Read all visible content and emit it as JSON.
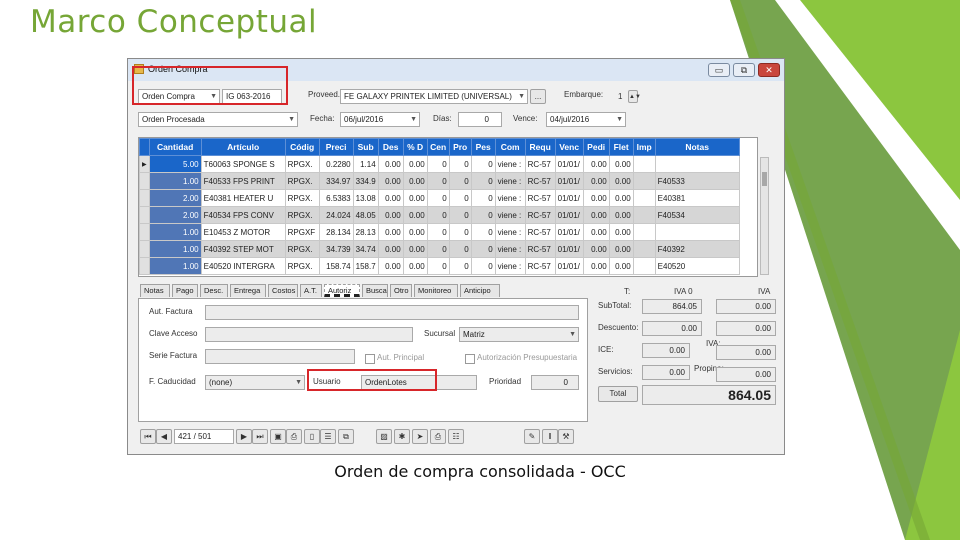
{
  "slide": {
    "title": "Marco Conceptual",
    "caption": "Orden de compra consolidada - OCC",
    "colors": {
      "title": "#76a636",
      "accent_green_dark": "#5f9530",
      "accent_green_light": "#8cc63f",
      "highlight_red": "#d7262a",
      "grid_header": "#1a66c9"
    }
  },
  "window": {
    "title": "Orden Compra",
    "controls": {
      "minimize": "▭",
      "restore": "⧉",
      "close": "✕"
    },
    "tipo": "Orden Compra",
    "numero": "IG 063-2016",
    "estado": "Orden Procesada",
    "proveedor_label": "Proveed.",
    "proveedor": "FE GALAXY PRINTEK LIMITED (UNIVERSAL)",
    "embarque_label": "Embarque:",
    "embarque": "1",
    "fecha_label": "Fecha:",
    "fecha": "06/jul/2016",
    "dias_label": "Días:",
    "dias": "0",
    "vence_label": "Vence:",
    "vence": "04/jul/2016",
    "ellipsis": "..."
  },
  "grid": {
    "columns": [
      "Cantidad",
      "Artículo",
      "Códig",
      "Preci",
      "Sub",
      "Des",
      "% D",
      "Cen",
      "Pro",
      "Pes",
      "Com",
      "Requ",
      "Venc",
      "Pedi",
      "Flet",
      "Imp",
      "Notas"
    ],
    "rows": [
      {
        "marker": "▶",
        "cells": [
          "5.00",
          "T60063 SPONGE S",
          "RPGX.",
          "0.2280",
          "1.14",
          "0.00",
          "0.00",
          "0",
          "0",
          "0",
          "viene :",
          "RC-57",
          "01/01/",
          "0.00",
          "0.00",
          "",
          ""
        ]
      },
      {
        "marker": "",
        "cells": [
          "1.00",
          "F40533 FPS PRINT",
          "RPGX.",
          "334.97",
          "334.9",
          "0.00",
          "0.00",
          "0",
          "0",
          "0",
          "viene :",
          "RC-57",
          "01/01/",
          "0.00",
          "0.00",
          "",
          "F40533"
        ]
      },
      {
        "marker": "",
        "cells": [
          "2.00",
          "E40381 HEATER U",
          "RPGX.",
          "6.5383",
          "13.08",
          "0.00",
          "0.00",
          "0",
          "0",
          "0",
          "viene :",
          "RC-57",
          "01/01/",
          "0.00",
          "0.00",
          "",
          "E40381"
        ]
      },
      {
        "marker": "",
        "cells": [
          "2.00",
          "F40534 FPS CONV",
          "RPGX.",
          "24.024",
          "48.05",
          "0.00",
          "0.00",
          "0",
          "0",
          "0",
          "viene :",
          "RC-57",
          "01/01/",
          "0.00",
          "0.00",
          "",
          "F40534"
        ]
      },
      {
        "marker": "",
        "cells": [
          "1.00",
          "E10453 Z MOTOR",
          "RPGXF",
          "28.134",
          "28.13",
          "0.00",
          "0.00",
          "0",
          "0",
          "0",
          "viene :",
          "RC-57",
          "01/01/",
          "0.00",
          "0.00",
          "",
          ""
        ]
      },
      {
        "marker": "",
        "cells": [
          "1.00",
          "F40392 STEP MOT",
          "RPGX.",
          "34.739",
          "34.74",
          "0.00",
          "0.00",
          "0",
          "0",
          "0",
          "viene :",
          "RC-57",
          "01/01/",
          "0.00",
          "0.00",
          "",
          "F40392"
        ]
      },
      {
        "marker": "",
        "cells": [
          "1.00",
          "E40520 INTERGRA",
          "RPGX.",
          "158.74",
          "158.7",
          "0.00",
          "0.00",
          "0",
          "0",
          "0",
          "viene :",
          "RC-57",
          "01/01/",
          "0.00",
          "0.00",
          "",
          "E40520"
        ]
      }
    ]
  },
  "tabs": [
    "Notas",
    "Pago",
    "Desc.",
    "Entrega",
    "Costos",
    "A.T.",
    "Autoriz",
    "Busca",
    "Otro",
    "Monitoreo",
    "Anticipo"
  ],
  "autoriz": {
    "aut_factura_label": "Aut. Factura",
    "clave_acceso_label": "Clave Acceso",
    "sucursal_label": "Sucursal",
    "sucursal_value": "Matriz",
    "serie_factura_label": "Serie Factura",
    "aut_principal_label": "Aut. Principal",
    "aut_presupuestaria_label": "Autorización Presupuestaria",
    "caducidad_label": "F. Caducidad",
    "caducidad_value": "(none)",
    "usuario_label": "Usuario",
    "usuario_value": "OrdenLotes",
    "prioridad_label": "Prioridad",
    "prioridad_value": "0"
  },
  "totals": {
    "t_label": "T:",
    "iva0_label": "IVA 0",
    "iva_label": "IVA",
    "subtotal_label": "SubTotal:",
    "subtotal_iva0": "864.05",
    "subtotal_iva": "0.00",
    "descuento_label": "Descuento:",
    "descuento_iva0": "0.00",
    "descuento_iva": "0.00",
    "ice_label": "ICE:",
    "ice_value": "0.00",
    "iva_row_label": "IVA:",
    "iva_row_value": "0.00",
    "servicios_label": "Servicios:",
    "servicios_value": "0.00",
    "propina_label": "Propina:",
    "propina_value": "0.00",
    "total_button": "Total",
    "total_value": "864.05"
  },
  "navigator": {
    "record": "421 / 501",
    "first": "⏮",
    "prev": "◀",
    "next": "▶",
    "last": "⏭"
  }
}
